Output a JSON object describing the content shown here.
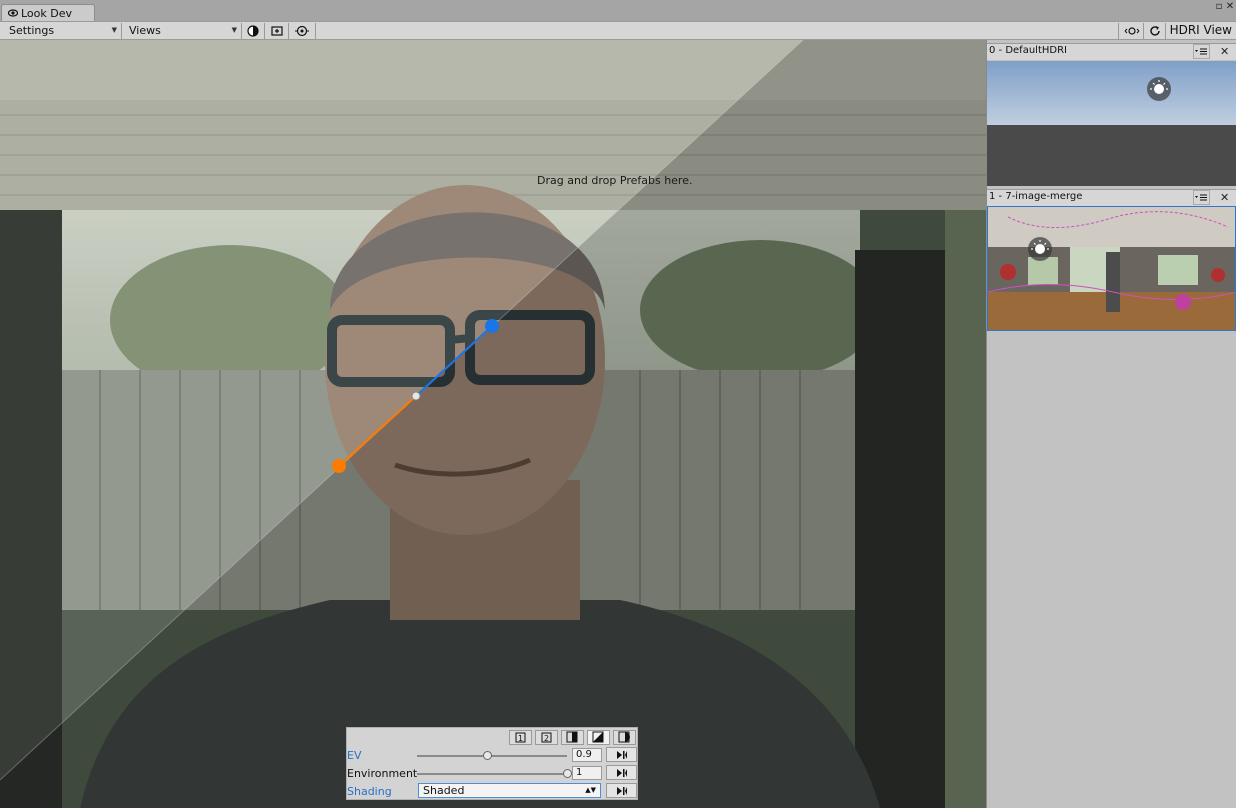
{
  "window": {
    "tab_title": "Look Dev",
    "icons": [
      "eye-icon",
      "maximize-icon",
      "close-icon"
    ]
  },
  "toolbar": {
    "settings_label": "Settings",
    "views_label": "Views",
    "buttons": [
      "sphere-toggle-icon",
      "frame-icon",
      "target-icon"
    ],
    "right_buttons": [
      "light-visibility-icon",
      "refresh-icon"
    ],
    "hdri_view_label": "HDRI View"
  },
  "viewport": {
    "drop_message": "Drag and drop Prefabs here.",
    "gizmo_colors": {
      "left": "#ff7a00",
      "right": "#1a75e8",
      "center": "#e6e6e6"
    }
  },
  "controls": {
    "mode_buttons": [
      "1",
      "2",
      "split-vertical",
      "split-diagonal",
      "split-circle"
    ],
    "active_mode": "split-diagonal",
    "ev_label": "EV",
    "ev_value": "0.9",
    "ev_slider_fraction": 0.47,
    "environment_label": "Environment",
    "environment_value": "1",
    "environment_slider_fraction": 1.0,
    "shading_label": "Shading",
    "shading_value": "Shaded"
  },
  "hdri_list": [
    {
      "name": "0 - DefaultHDRI"
    },
    {
      "name": "1 - 7-image-merge"
    }
  ]
}
